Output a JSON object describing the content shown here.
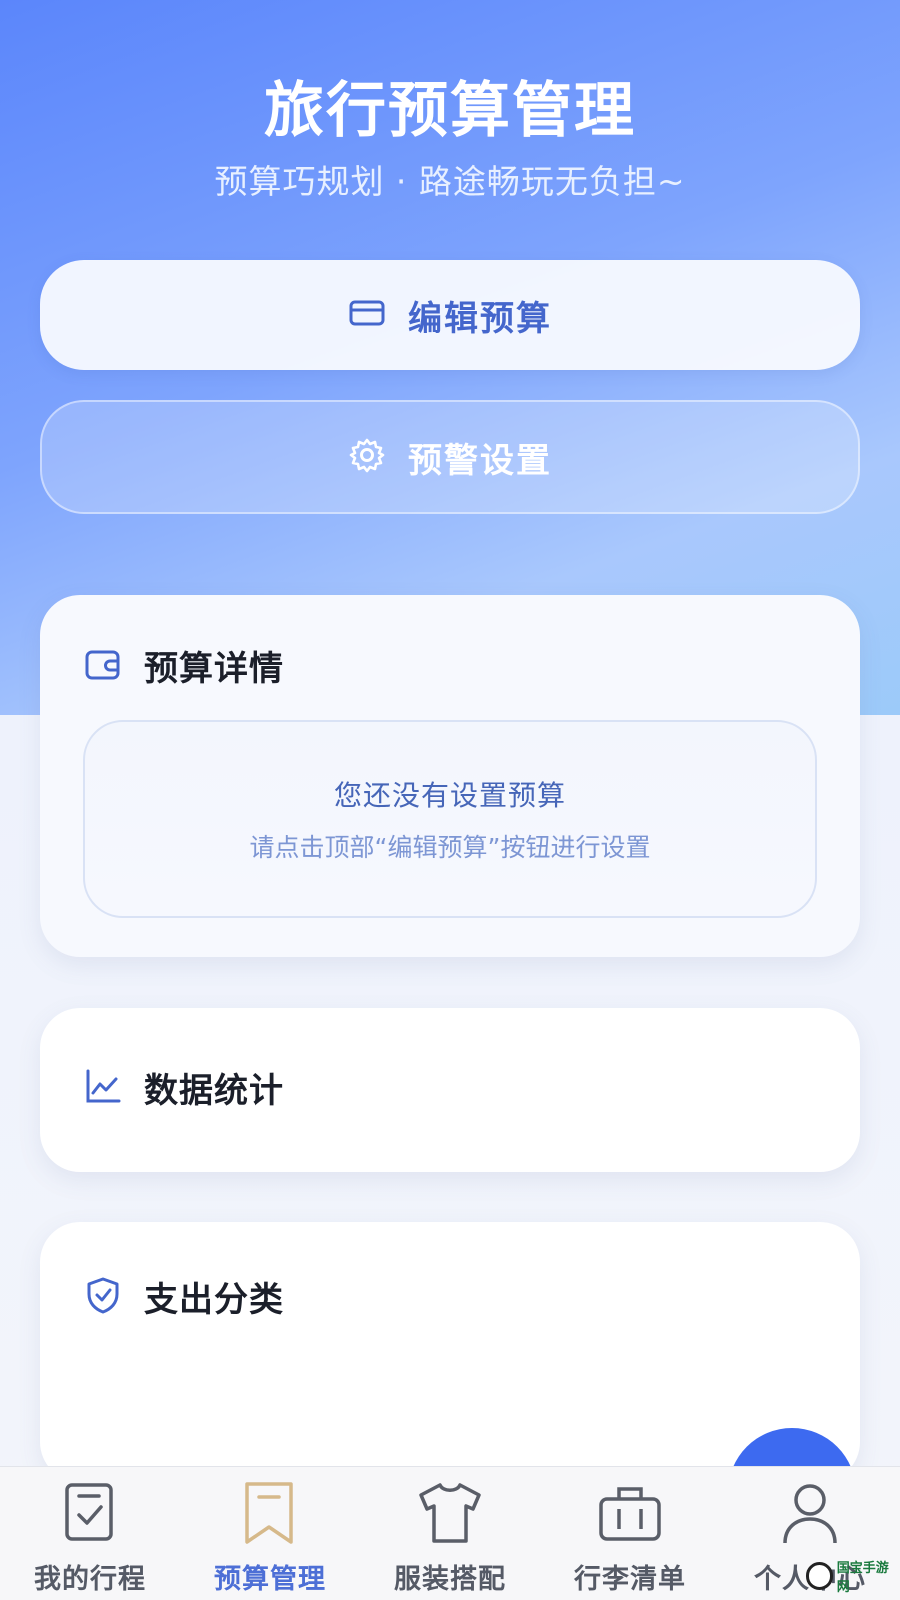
{
  "header": {
    "title": "旅行预算管理",
    "subtitle": "预算巧规划 · 路途畅玩无负担~"
  },
  "actions": {
    "edit_budget": {
      "label": "编辑预算",
      "icon": "credit-card-icon"
    },
    "alert_settings": {
      "label": "预警设置",
      "icon": "gear-icon"
    }
  },
  "budget_detail": {
    "title": "预算详情",
    "icon": "wallet-icon",
    "empty_message": "您还没有设置预算",
    "empty_hint": "请点击顶部“编辑预算”按钮进行设置"
  },
  "statistics": {
    "title": "数据统计",
    "icon": "line-chart-icon"
  },
  "categories": {
    "title": "支出分类",
    "icon": "shield-check-icon"
  },
  "tabbar": {
    "items": [
      {
        "label": "我的行程",
        "icon": "checklist-icon"
      },
      {
        "label": "预算管理",
        "icon": "bookmark-icon",
        "active": true
      },
      {
        "label": "服装搭配",
        "icon": "tshirt-icon"
      },
      {
        "label": "行李清单",
        "icon": "suitcase-icon"
      },
      {
        "label": "个人中心",
        "icon": "user-icon"
      }
    ]
  },
  "watermark": {
    "text": "国宝手游网"
  },
  "colors": {
    "accent": "#4466cc",
    "hero_start": "#5b86fb",
    "hero_end": "#9ccaf9",
    "active_tab": "#4d6fd6",
    "fab": "#3d6af0"
  }
}
